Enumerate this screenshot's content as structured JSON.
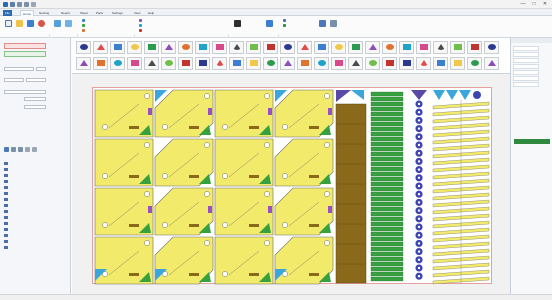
{
  "window": {
    "title": "",
    "controls": [
      "—",
      "□",
      "✕"
    ],
    "quick_access_icons": [
      "app-logo-icon",
      "save-icon",
      "undo-icon",
      "redo-icon",
      "print-icon"
    ]
  },
  "tabs": [
    "File",
    "Home",
    "Nesting",
    "Report",
    "Sheet",
    "Parts",
    "Settings",
    "View",
    "Help"
  ],
  "active_tab": 1,
  "ribbon": {
    "groups": [
      {
        "label": "",
        "buttons": [
          "",
          "",
          "",
          ""
        ]
      },
      {
        "label": "",
        "buttons": [
          "",
          ""
        ]
      },
      {
        "label": "",
        "small": [
          "",
          "",
          ""
        ]
      },
      {
        "label": "",
        "small": [
          "",
          "",
          ""
        ]
      },
      {
        "label": "",
        "buttons": [
          "",
          ""
        ]
      },
      {
        "label": "",
        "small": [
          "",
          ""
        ]
      }
    ]
  },
  "left_panel": {
    "top_buttons": [
      "",
      ""
    ],
    "fields": [
      "",
      "",
      "",
      "",
      "",
      ""
    ],
    "tree_header": "",
    "tree_items": [
      {
        "label": "",
        "qty": ""
      },
      {
        "label": "",
        "qty": ""
      },
      {
        "label": "",
        "qty": ""
      },
      {
        "label": "",
        "qty": ""
      },
      {
        "label": "",
        "qty": ""
      },
      {
        "label": "",
        "qty": ""
      },
      {
        "label": "",
        "qty": ""
      },
      {
        "label": "",
        "qty": ""
      },
      {
        "label": "",
        "qty": ""
      },
      {
        "label": "",
        "qty": ""
      },
      {
        "label": "",
        "qty": ""
      },
      {
        "label": "",
        "qty": ""
      },
      {
        "label": "",
        "qty": ""
      },
      {
        "label": "",
        "qty": ""
      },
      {
        "label": "",
        "qty": ""
      }
    ]
  },
  "part_strip": {
    "colors": [
      "#2b3a8f",
      "#e34b4b",
      "#3a7fd1",
      "#f2c84b",
      "#2c9a4f",
      "#8c4fb8",
      "#e0722f",
      "#1fa3c9",
      "#d64a8c",
      "#4b4b4b",
      "#6fbf4a",
      "#c2332e"
    ]
  },
  "canvas": {
    "sheet_label": "",
    "side_label": ""
  },
  "right_panel": {
    "header": "",
    "rows": [
      "",
      "",
      "",
      "",
      "",
      "",
      ""
    ],
    "action": ""
  },
  "status_bar": {
    "left": "",
    "right": ""
  },
  "colors": {
    "part_yellow": "#f2ea6a",
    "part_outline": "#6a6a6a",
    "part_purple": "#5a4aa6",
    "part_blue": "#3aa6dc",
    "part_green": "#37a13f",
    "part_brown": "#8a6a1a",
    "part_navy": "#3c44b0",
    "sheet_border": "#e7a0a0"
  }
}
